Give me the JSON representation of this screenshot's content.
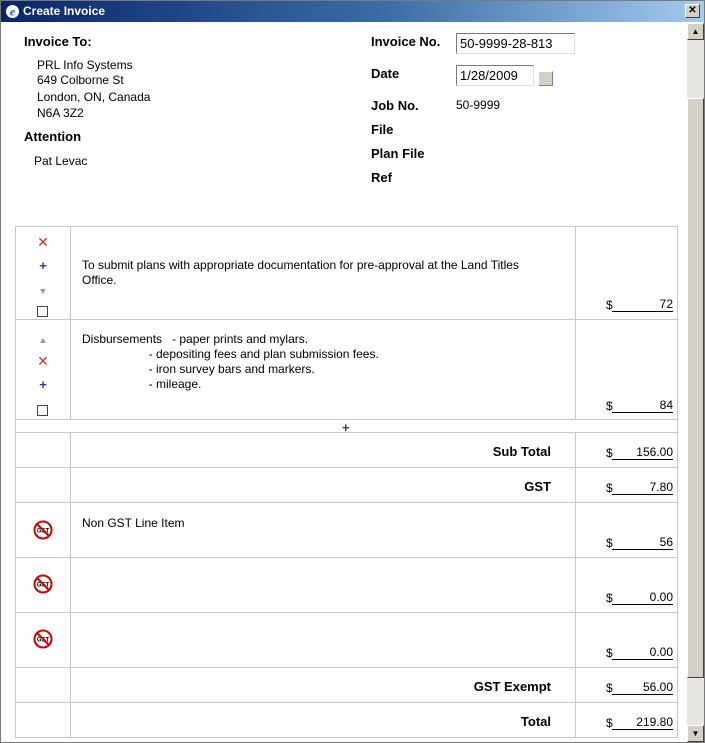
{
  "window": {
    "title": "Create Invoice",
    "close_label": "✕"
  },
  "header": {
    "invoice_to_label": "Invoice To:",
    "address": [
      "PRL Info Systems",
      "649 Colborne St",
      "London, ON, Canada",
      "N6A 3Z2"
    ],
    "attention_label": "Attention",
    "attention_value": "Pat Levac",
    "invoice_no_label": "Invoice No.",
    "invoice_no_value": "50-9999-28-813",
    "date_label": "Date",
    "date_value": "1/28/2009",
    "job_no_label": "Job No.",
    "job_no_value": "50-9999",
    "file_label": "File",
    "plan_file_label": "Plan File",
    "ref_label": "Ref"
  },
  "line_items": [
    {
      "description": "To submit plans with appropriate documentation for pre-approval at the Land Titles\nOffice.",
      "currency": "$",
      "amount": "72"
    },
    {
      "description": "Disbursements   - paper prints and mylars.\n                    - depositing fees and plan submission fees.\n                    - iron survey bars and markers.\n                    - mileage.",
      "currency": "$",
      "amount": "84"
    }
  ],
  "subtotal": {
    "label": "Sub Total",
    "currency": "$",
    "amount": "156.00"
  },
  "gst": {
    "label": "GST",
    "currency": "$",
    "amount": "7.80"
  },
  "non_gst_items": [
    {
      "description": "Non GST Line Item",
      "currency": "$",
      "amount": "56",
      "icon_label": "GST"
    },
    {
      "description": "",
      "currency": "$",
      "amount": "0.00",
      "icon_label": "GST"
    },
    {
      "description": "",
      "currency": "$",
      "amount": "0.00",
      "icon_label": "GST"
    }
  ],
  "gst_exempt": {
    "label": "GST Exempt",
    "currency": "$",
    "amount": "56.00"
  },
  "total": {
    "label": "Total",
    "currency": "$",
    "amount": "219.80"
  },
  "icons": {
    "delete": "✕",
    "add": "+",
    "move_up": "▲",
    "move_down": "▼",
    "scroll_up": "▲",
    "scroll_down": "▼"
  },
  "colors": {
    "title_start": "#0a246a",
    "title_end": "#a6caf0",
    "delete": "#cc3333",
    "add": "#3333aa",
    "no_gst": "#cc0000"
  }
}
